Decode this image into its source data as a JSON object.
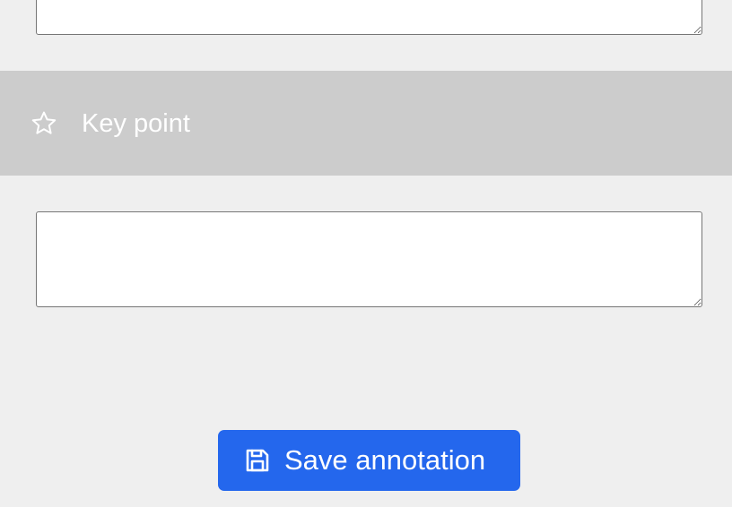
{
  "top_textarea": {
    "value": "",
    "placeholder": ""
  },
  "section": {
    "title": "Key point",
    "icon": "star-icon"
  },
  "main_textarea": {
    "value": "",
    "placeholder": ""
  },
  "save_button": {
    "label": "Save annotation",
    "icon": "save-icon"
  },
  "colors": {
    "background": "#efefef",
    "section_header": "#cccccc",
    "primary_button": "#2467ed",
    "text_on_dark": "#ffffff"
  }
}
